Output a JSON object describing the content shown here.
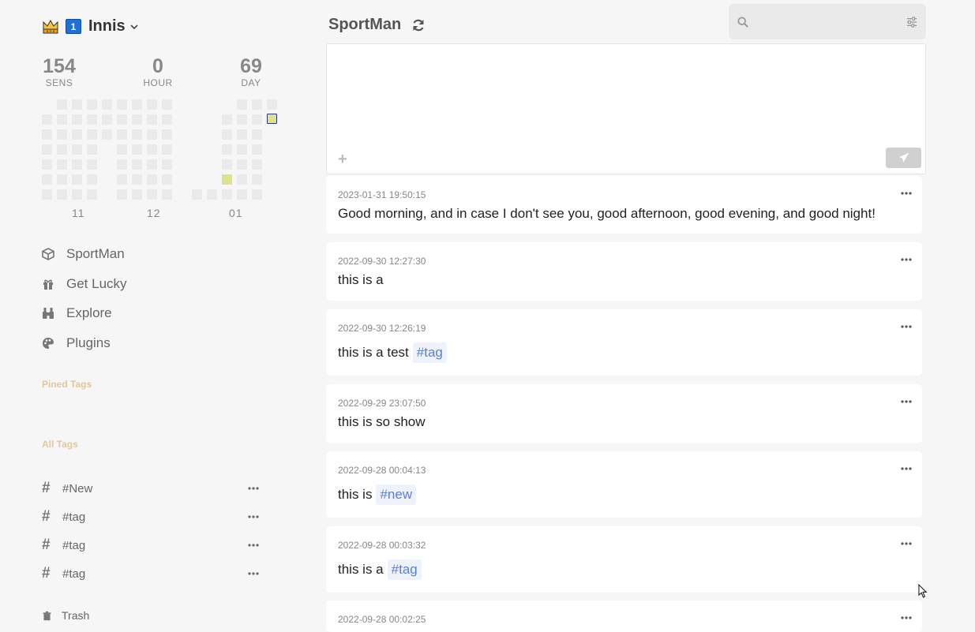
{
  "user": {
    "name": "Innis",
    "badge": "1"
  },
  "stats": [
    {
      "value": "154",
      "label": "SENS"
    },
    {
      "value": "0",
      "label": "HOUR"
    },
    {
      "value": "69",
      "label": "DAY"
    }
  ],
  "heatmap": {
    "months": [
      "11",
      "12",
      "01"
    ],
    "empty_color": "#eaeaea",
    "active_color": "#dde38a",
    "today_border": "#2a3a7a"
  },
  "nav": [
    {
      "label": "SportMan",
      "icon": "box-icon"
    },
    {
      "label": "Get Lucky",
      "icon": "gift-icon"
    },
    {
      "label": "Explore",
      "icon": "binoculars-icon"
    },
    {
      "label": "Plugins",
      "icon": "palette-icon"
    }
  ],
  "sections": {
    "pinned": "Pined Tags",
    "all": "All Tags",
    "trash": "Trash"
  },
  "tags": [
    "#New",
    "#tag",
    "#tag",
    "#tag"
  ],
  "header": {
    "title": "SportMan"
  },
  "search": {
    "placeholder": ""
  },
  "editor": {
    "placeholder": "",
    "add": "+"
  },
  "memos": [
    {
      "time": "2023-01-31 19:50:15",
      "text": "Good morning, and in case I don't see you, good afternoon, good evening, and good night!",
      "tag": ""
    },
    {
      "time": "2022-09-30 12:27:30",
      "text": "this is a",
      "tag": ""
    },
    {
      "time": "2022-09-30 12:26:19",
      "text": "this is a test",
      "tag": "#tag"
    },
    {
      "time": "2022-09-29 23:07:50",
      "text": "this is so show",
      "tag": ""
    },
    {
      "time": "2022-09-28 00:04:13",
      "text": "this is",
      "tag": "#new"
    },
    {
      "time": "2022-09-28 00:03:32",
      "text": "this is a",
      "tag": "#tag"
    },
    {
      "time": "2022-09-28 00:02:25",
      "text": "",
      "tag": ""
    }
  ],
  "colors": {
    "accent": "#5b7fd6",
    "section": "#e3c79c"
  }
}
